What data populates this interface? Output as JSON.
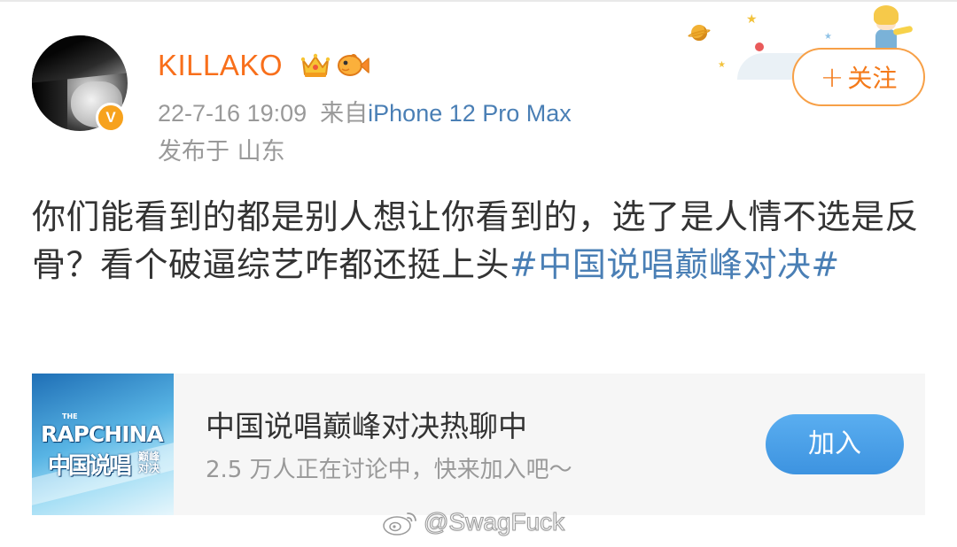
{
  "colors": {
    "username": "#f86f1b",
    "link": "#4a7fb5",
    "meta": "#999999",
    "follow_border": "#f7a047",
    "join_button": "#3d93e0",
    "verify_badge": "#f7a21d"
  },
  "header": {
    "username": "KILLAKO",
    "badges": [
      "crown-icon",
      "fish-icon"
    ],
    "verified_mark": "V",
    "timestamp": "22-7-16 19:09",
    "source_prefix": "来自",
    "device": "iPhone 12 Pro Max",
    "location": "发布于 山东",
    "follow_plus": "+",
    "follow_label": "关注"
  },
  "post": {
    "text": "你们能看到的都是别人想让你看到的，选了是人情不选是反骨？看个破逼综艺咋都还挺上头",
    "hashtag": "#中国说唱巅峰对决#"
  },
  "topic_card": {
    "thumb_small": "THE",
    "thumb_logo": "RAPCHINA",
    "thumb_sub": "中国说唱",
    "thumb_sub2": "巅峰对决",
    "title": "中国说唱巅峰对决热聊中",
    "subtitle": "2.5 万人正在讨论中，快来加入吧～",
    "join_label": "加入"
  },
  "watermark": {
    "text": "@SwagFuck",
    "icon": "weibo-icon"
  }
}
